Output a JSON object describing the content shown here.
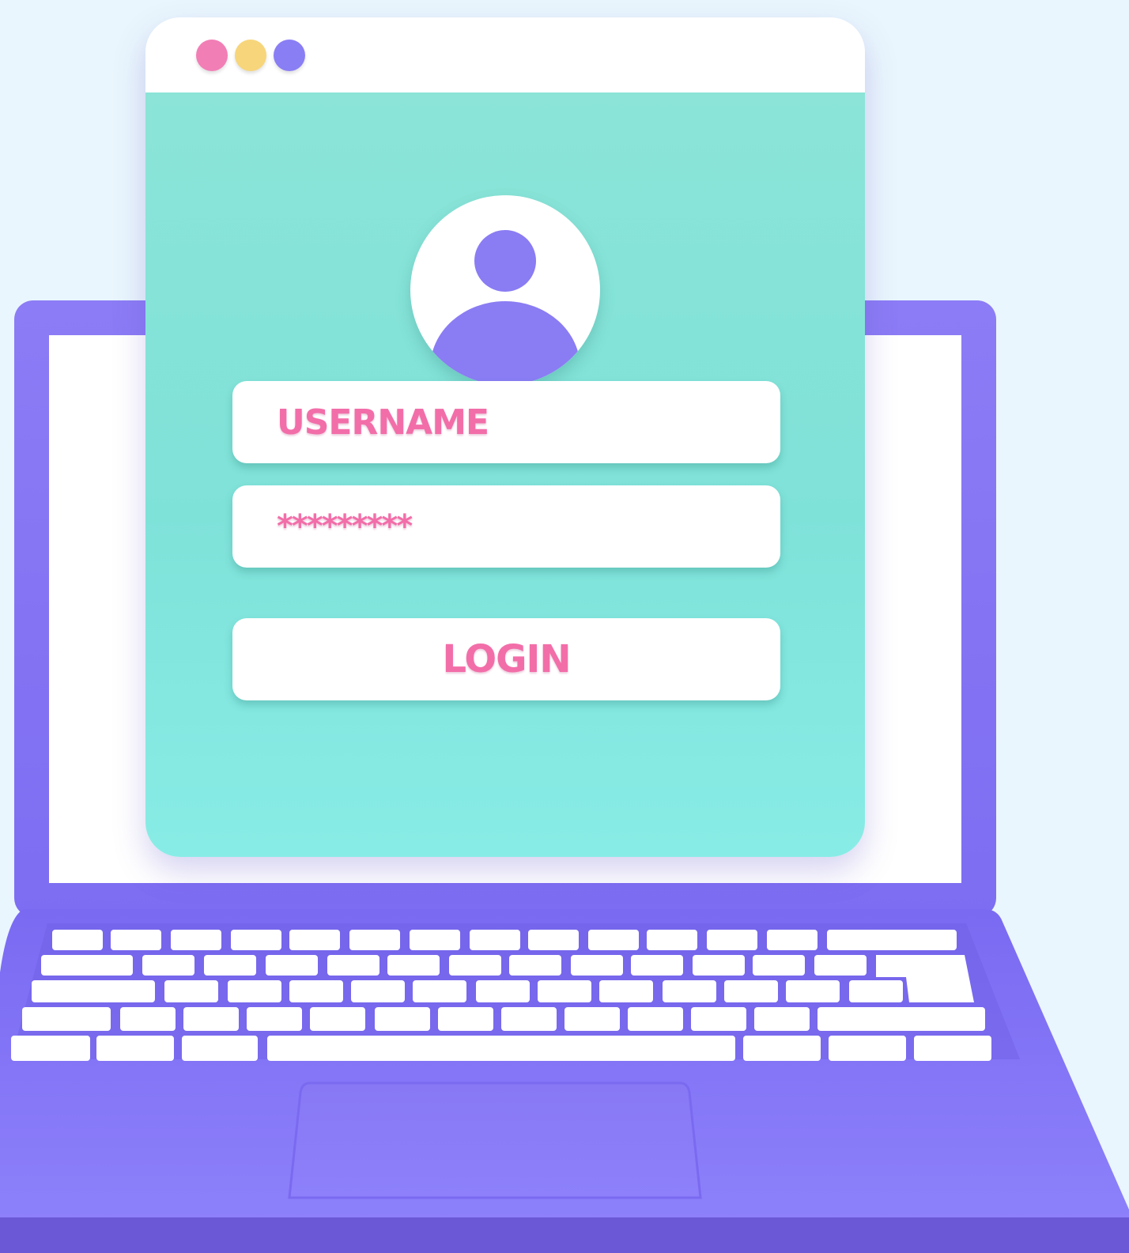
{
  "window": {
    "controls": [
      {
        "name": "close-dot",
        "color": "#f27eb6"
      },
      {
        "name": "minimize-dot",
        "color": "#f7d57a"
      },
      {
        "name": "maximize-dot",
        "color": "#8a7ef5"
      }
    ]
  },
  "login_form": {
    "avatar_icon": "user-avatar-icon",
    "username_field": "USERNAME",
    "password_field": "*********",
    "login_button": "LOGIN"
  },
  "colors": {
    "background": "#eaf6fd",
    "card": "#82e3d9",
    "laptop": "#8376f3",
    "text_accent": "#f26ea9"
  }
}
